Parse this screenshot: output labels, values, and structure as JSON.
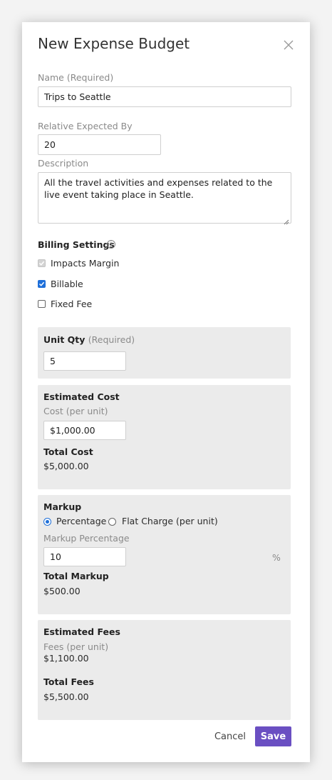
{
  "dialog": {
    "title": "New Expense Budget"
  },
  "fields": {
    "name_label": "Name (Required)",
    "name_value": "Trips to Seattle",
    "relative_label": "Relative Expected By",
    "relative_value": "20",
    "description_label": "Description",
    "description_value": "All the travel activities and expenses related to the live event taking place in Seattle."
  },
  "billing": {
    "title": "Billing Settings",
    "info_icon": "info-icon",
    "options": [
      {
        "label": "Impacts Margin",
        "checked": true,
        "disabled": true
      },
      {
        "label": "Billable",
        "checked": true,
        "disabled": false
      },
      {
        "label": "Fixed Fee",
        "checked": false,
        "disabled": false
      }
    ]
  },
  "unit_qty": {
    "title": "Unit Qty",
    "required": "(Required)",
    "value": "5"
  },
  "estimated_cost": {
    "title": "Estimated Cost",
    "cost_label": "Cost (per unit)",
    "cost_value": "$1,000.00",
    "total_label": "Total Cost",
    "total_value": "$5,000.00"
  },
  "markup": {
    "title": "Markup",
    "radio_percentage": "Percentage",
    "radio_flat": "Flat Charge (per unit)",
    "selected": "Percentage",
    "percent_label": "Markup Percentage",
    "percent_value": "10",
    "percent_suffix": "%",
    "total_label": "Total Markup",
    "total_value": "$500.00"
  },
  "estimated_fees": {
    "title": "Estimated Fees",
    "fees_label": "Fees (per unit)",
    "fees_value": "$1,100.00",
    "total_label": "Total Fees",
    "total_value": "$5,500.00"
  },
  "actions": {
    "cancel": "Cancel",
    "save": "Save"
  },
  "colors": {
    "accent": "#6a4fc2",
    "checkbox": "#1e6fd9",
    "panel_bg": "#ebebeb"
  }
}
